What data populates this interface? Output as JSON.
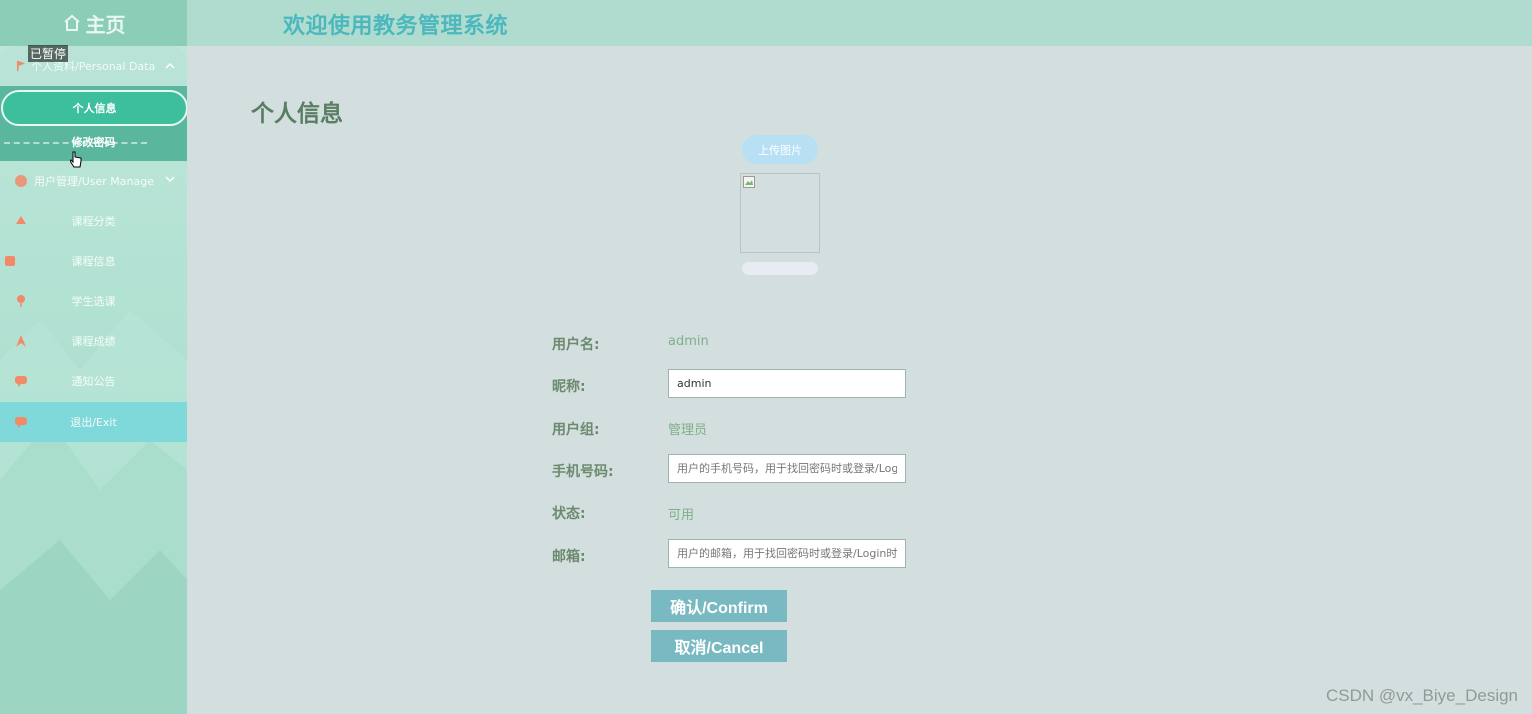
{
  "sidebar": {
    "home_label": "主页",
    "paused_label": "已暂停",
    "group_personal": "个人资料/Personal Data",
    "submenu": [
      "个人信息",
      "修改密码"
    ],
    "group_user_manage": "用户管理/User Manage",
    "items": [
      "课程分类",
      "课程信息",
      "学生选课",
      "课程成绩",
      "通知公告",
      "退出/Exit"
    ]
  },
  "header": {
    "title": "欢迎使用教务管理系统"
  },
  "main": {
    "page_title": "个人信息",
    "upload_label": "上传图片",
    "fields": {
      "username_label": "用户名:",
      "username_value": "admin",
      "nickname_label": "昵称:",
      "nickname_value": "admin",
      "usergroup_label": "用户组:",
      "usergroup_value": "管理员",
      "phone_label": "手机号码:",
      "phone_placeholder": "用户的手机号码，用于找回密码时或登录/Login时",
      "status_label": "状态:",
      "status_value": "可用",
      "email_label": "邮箱:",
      "email_placeholder": "用户的邮箱，用于找回密码时或登录/Login时"
    },
    "confirm_label": "确认/Confirm",
    "cancel_label": "取消/Cancel"
  },
  "watermark": "CSDN @vx_Biye_Design",
  "colors": {
    "accent": "#3dbf9e",
    "header_title": "#4cb8be",
    "button": "#79b9c2",
    "icon": "#f28a68"
  }
}
